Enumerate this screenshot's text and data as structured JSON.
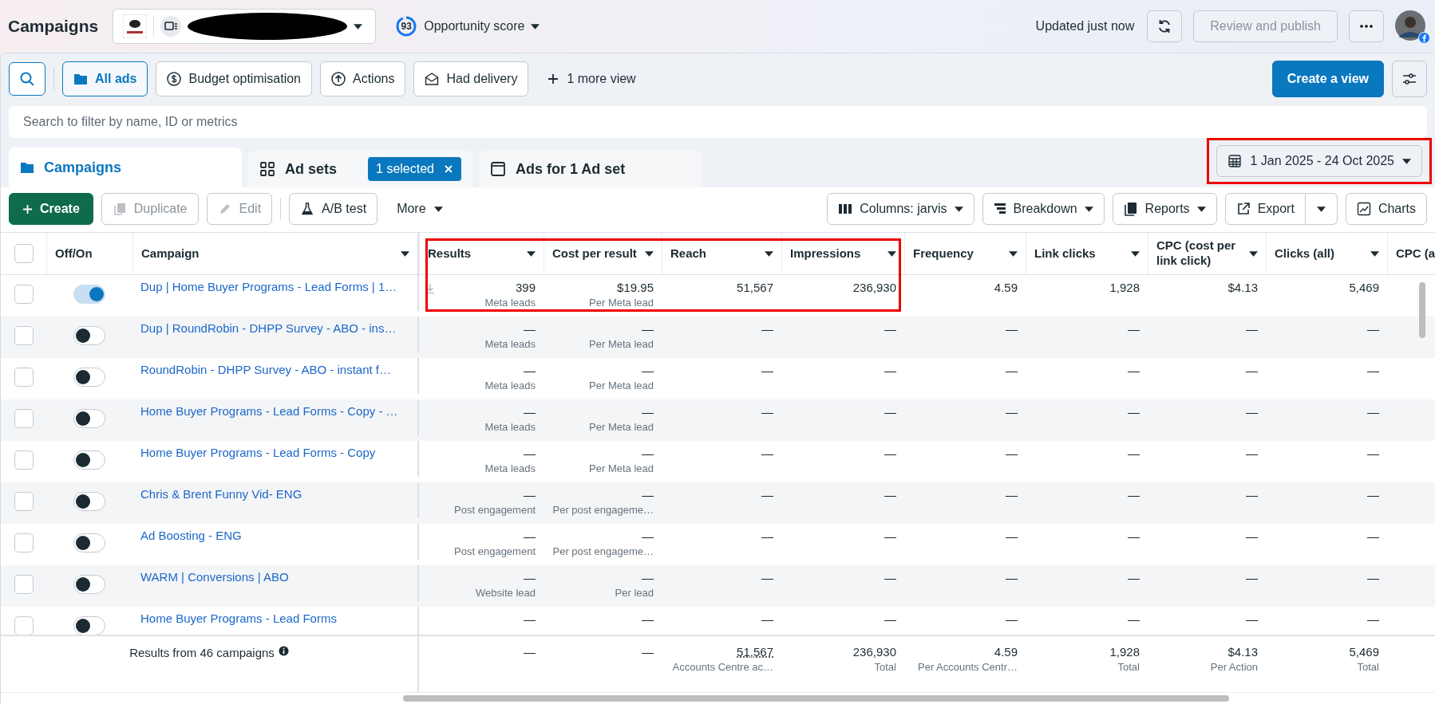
{
  "header": {
    "title": "Campaigns",
    "opportunity": {
      "score": "93",
      "label": "Opportunity score",
      "level": 0.93
    },
    "updated": "Updated just now",
    "publish_button": {
      "label": "Review and publish",
      "disabled": true
    }
  },
  "views": [
    {
      "label": "All ads",
      "kind": "folder",
      "selected": true
    },
    {
      "label": "Budget optimisation",
      "kind": "dollar",
      "selected": false
    },
    {
      "label": "Actions",
      "kind": "upload",
      "selected": false
    },
    {
      "label": "Had delivery",
      "kind": "envelope",
      "selected": false
    }
  ],
  "more_views": "1 more view",
  "create_view": "Create a view",
  "search": {
    "placeholder": "Search to filter by name, ID or metrics"
  },
  "tabs": [
    {
      "label": "Campaigns",
      "kind": "folder",
      "selected": true
    },
    {
      "label": "Ad sets",
      "kind": "grid",
      "selected": false,
      "badge": "1 selected"
    },
    {
      "label": "Ads for 1 Ad set",
      "kind": "window",
      "selected": false
    }
  ],
  "date_range": "1 Jan 2025 - 24 Oct 2025",
  "actions": {
    "create": "Create",
    "duplicate": {
      "label": "Duplicate",
      "disabled": true
    },
    "edit": {
      "label": "Edit",
      "disabled": true
    },
    "ab_test": "A/B test",
    "more": "More",
    "columns": "Columns: jarvis",
    "breakdown": "Breakdown",
    "reports": "Reports",
    "export": "Export",
    "charts": "Charts"
  },
  "table": {
    "select_all_checked": false,
    "columns": [
      {
        "label": "Off/On",
        "caret": false
      },
      {
        "label": "Campaign",
        "caret": true
      },
      {
        "label": "Results",
        "caret": true
      },
      {
        "label": "Cost per result",
        "caret": true
      },
      {
        "label": "Reach",
        "caret": true
      },
      {
        "label": "Impressions",
        "caret": true
      },
      {
        "label": "Frequency",
        "caret": true
      },
      {
        "label": "Link clicks",
        "caret": true
      },
      {
        "label": "CPC (cost per link click)",
        "caret": true
      },
      {
        "label": "Clicks (all)",
        "caret": true
      },
      {
        "label": "CPC (a"
      }
    ],
    "rows": [
      {
        "on": true,
        "checked": false,
        "name": "Dup | Home Buyer Programs - Lead Forms | 1…",
        "download_icon": true,
        "metrics": [
          {
            "value": "399",
            "label": "Meta leads"
          },
          {
            "value": "$19.95",
            "label": "Per Meta lead"
          },
          {
            "value": "51,567"
          },
          {
            "value": "236,930"
          },
          {
            "value": "4.59"
          },
          {
            "value": "1,928"
          },
          {
            "value": "$4.13"
          },
          {
            "value": "5,469"
          }
        ]
      },
      {
        "on": false,
        "checked": false,
        "name": "Dup | RoundRobin - DHPP Survey - ABO - ins…",
        "metrics": [
          {
            "value": "—",
            "label": "Meta leads"
          },
          {
            "value": "—",
            "label": "Per Meta lead"
          },
          {
            "value": "—"
          },
          {
            "value": "—"
          },
          {
            "value": "—"
          },
          {
            "value": "—"
          },
          {
            "value": "—"
          },
          {
            "value": "—"
          }
        ]
      },
      {
        "on": false,
        "checked": false,
        "name": "RoundRobin - DHPP Survey - ABO - instant f…",
        "metrics": [
          {
            "value": "—",
            "label": "Meta leads"
          },
          {
            "value": "—",
            "label": "Per Meta lead"
          },
          {
            "value": "—"
          },
          {
            "value": "—"
          },
          {
            "value": "—"
          },
          {
            "value": "—"
          },
          {
            "value": "—"
          },
          {
            "value": "—"
          }
        ]
      },
      {
        "on": false,
        "checked": false,
        "name": "Home Buyer Programs - Lead Forms - Copy - …",
        "metrics": [
          {
            "value": "—",
            "label": "Meta leads"
          },
          {
            "value": "—",
            "label": "Per Meta lead"
          },
          {
            "value": "—"
          },
          {
            "value": "—"
          },
          {
            "value": "—"
          },
          {
            "value": "—"
          },
          {
            "value": "—"
          },
          {
            "value": "—"
          }
        ]
      },
      {
        "on": false,
        "checked": false,
        "name": "Home Buyer Programs - Lead Forms - Copy",
        "metrics": [
          {
            "value": "—",
            "label": "Meta leads"
          },
          {
            "value": "—",
            "label": "Per Meta lead"
          },
          {
            "value": "—"
          },
          {
            "value": "—"
          },
          {
            "value": "—"
          },
          {
            "value": "—"
          },
          {
            "value": "—"
          },
          {
            "value": "—"
          }
        ]
      },
      {
        "on": false,
        "checked": false,
        "name": "Chris & Brent Funny Vid- ENG",
        "metrics": [
          {
            "value": "—",
            "label": "Post engagement"
          },
          {
            "value": "—",
            "label": "Per post engageme…"
          },
          {
            "value": "—"
          },
          {
            "value": "—"
          },
          {
            "value": "—"
          },
          {
            "value": "—"
          },
          {
            "value": "—"
          },
          {
            "value": "—"
          }
        ]
      },
      {
        "on": false,
        "checked": false,
        "name": "Ad Boosting - ENG",
        "metrics": [
          {
            "value": "—",
            "label": "Post engagement"
          },
          {
            "value": "—",
            "label": "Per post engageme…"
          },
          {
            "value": "—"
          },
          {
            "value": "—"
          },
          {
            "value": "—"
          },
          {
            "value": "—"
          },
          {
            "value": "—"
          },
          {
            "value": "—"
          }
        ]
      },
      {
        "on": false,
        "checked": false,
        "name": "WARM | Conversions | ABO",
        "metrics": [
          {
            "value": "—",
            "label": "Website lead"
          },
          {
            "value": "—",
            "label": "Per lead"
          },
          {
            "value": "—"
          },
          {
            "value": "—"
          },
          {
            "value": "—"
          },
          {
            "value": "—"
          },
          {
            "value": "—"
          },
          {
            "value": "—"
          }
        ]
      },
      {
        "on": false,
        "checked": false,
        "name": "Home Buyer Programs - Lead Forms",
        "metrics": [
          {
            "value": "—"
          },
          {
            "value": "—"
          },
          {
            "value": "—"
          },
          {
            "value": "—"
          },
          {
            "value": "—"
          },
          {
            "value": "—"
          },
          {
            "value": "—"
          },
          {
            "value": "—"
          }
        ]
      }
    ],
    "footer": {
      "label": "Results from 46 campaigns",
      "totals": [
        {
          "value": "—"
        },
        {
          "value": "—"
        },
        {
          "value": "51,567",
          "label": "Accounts Centre ac…"
        },
        {
          "value": "236,930",
          "label": "Total"
        },
        {
          "value": "4.59",
          "label": "Per Accounts Centr…"
        },
        {
          "value": "1,928",
          "label": "Total"
        },
        {
          "value": "$4.13",
          "label": "Per Action"
        },
        {
          "value": "5,469",
          "label": "Total"
        }
      ]
    }
  }
}
